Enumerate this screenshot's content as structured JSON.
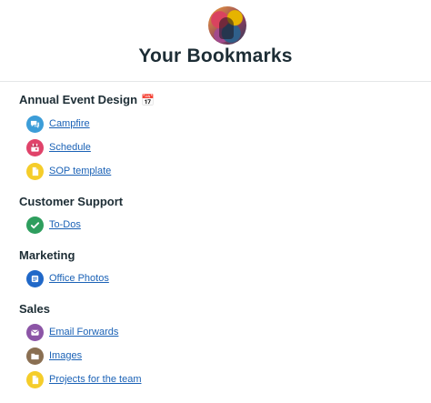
{
  "header": {
    "title": "Your Bookmarks"
  },
  "groups": [
    {
      "name": "Annual Event Design",
      "emoji": "📅",
      "items": [
        {
          "label": "Campfire",
          "icon": "chat-bubbles-icon",
          "color": "#3c9dd8"
        },
        {
          "label": "Schedule",
          "icon": "calendar-icon",
          "color": "#e0436a"
        },
        {
          "label": "SOP template",
          "icon": "document-icon",
          "color": "#f5cd2a"
        }
      ]
    },
    {
      "name": "Customer Support",
      "items": [
        {
          "label": "To-Dos",
          "icon": "checkmark-icon",
          "color": "#2e9e5e"
        }
      ]
    },
    {
      "name": "Marketing",
      "items": [
        {
          "label": "Office Photos",
          "icon": "message-board-icon",
          "color": "#2068c8"
        }
      ]
    },
    {
      "name": "Sales",
      "items": [
        {
          "label": "Email Forwards",
          "icon": "envelope-icon",
          "color": "#8c55a6"
        },
        {
          "label": "Images",
          "icon": "folder-icon",
          "color": "#8a6f52"
        },
        {
          "label": "Projects for the team",
          "icon": "document-icon",
          "color": "#f5cd2a"
        }
      ]
    }
  ]
}
